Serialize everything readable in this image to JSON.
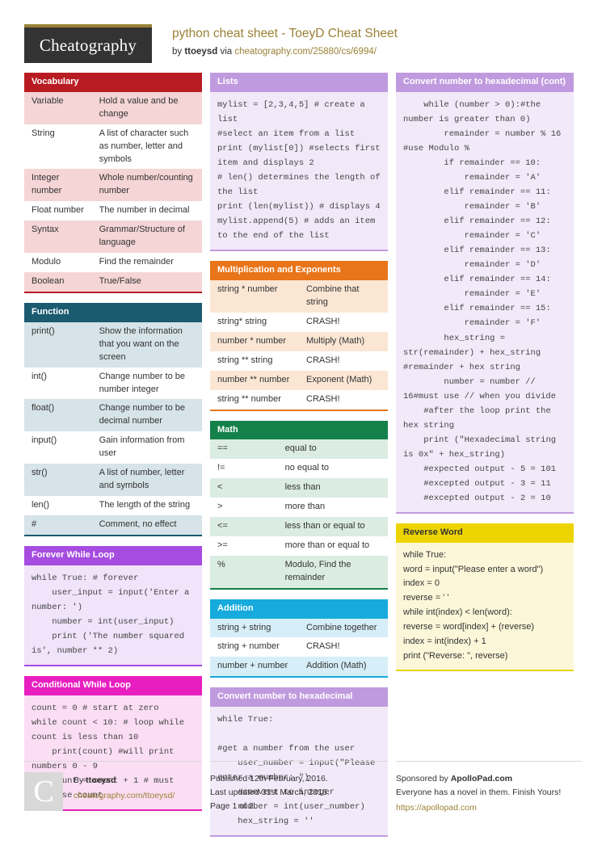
{
  "header": {
    "logo_text": "Cheatography",
    "sheet_title": "python cheat sheet - ToeyD Cheat Sheet",
    "by_prefix": "by ",
    "author": "ttoeysd",
    "via": " via ",
    "source_link": "cheatography.com/25880/cs/6994/"
  },
  "colors": {
    "brand_gold": "#9a8236",
    "vocabulary": "#b81c22",
    "function": "#1a5b70",
    "forever_while_loop": "#a64ce0",
    "conditional_while_loop": "#e81ec0",
    "lists": "#c09ade",
    "multiplication": "#e8751a",
    "math": "#14804a",
    "addition": "#16aadd",
    "hexadecimal": "#c09ade",
    "reverse_word": "#edd400"
  },
  "column1": {
    "vocabulary": {
      "title": "Vocabulary",
      "rows": [
        [
          "Variable",
          "Hold a value and be change"
        ],
        [
          "String",
          "A list of character such as number, letter and symbols"
        ],
        [
          "Integer number",
          "Whole number/counting number"
        ],
        [
          "Float number",
          "The number in decimal"
        ],
        [
          "Syntax",
          "Grammar/Structure of language"
        ],
        [
          "Modulo",
          "Find the remainder"
        ],
        [
          "Boolean",
          "True/False"
        ]
      ]
    },
    "function": {
      "title": "Function",
      "rows": [
        [
          "print()",
          "Show the information that you want on the screen"
        ],
        [
          "int()",
          "Change number to be number integer"
        ],
        [
          "float()",
          "Change number to be decimal number"
        ],
        [
          "input()",
          "Gain information from user"
        ],
        [
          "str()",
          "A list of number, letter and symbols"
        ],
        [
          "len()",
          "The length of the string"
        ],
        [
          "#",
          "Comment, no effect"
        ]
      ]
    },
    "forever_while_loop": {
      "title": "Forever While Loop",
      "code": "while True: # forever\n    user_input = input('Enter a number: ')\n    number = int(user_input)\n    print ('The number squared is', number ** 2)"
    },
    "conditional_while_loop": {
      "title": "Conditional While Loop",
      "code": "count = 0 # start at zero\nwhile count < 10: # loop while count is less than 10\n    print(count) #will print numbers 0 - 9\n    count = count + 1 # must increase count"
    }
  },
  "column2": {
    "lists": {
      "title": "Lists",
      "code": "mylist = [2,3,4,5] # create a list\n#select an item from a list\nprint (mylist[0]) #selects first item and displays 2\n# len() determines the length of the list\nprint (len(mylist)) # displays 4\nmylist.append(5) # adds an item to the end of the list"
    },
    "multiplication": {
      "title": "Multiplication and Exponents",
      "rows": [
        [
          "string * number",
          "Combine that string"
        ],
        [
          "string* string",
          "CRASH!"
        ],
        [
          "number * number",
          "Multiply (Math)"
        ],
        [
          "string ** string",
          "CRASH!"
        ],
        [
          "number ** number",
          "Exponent (Math)"
        ],
        [
          "string ** number",
          "CRASH!"
        ]
      ]
    },
    "math": {
      "title": "Math",
      "rows": [
        [
          "==",
          "equal to"
        ],
        [
          "!=",
          "no equal to"
        ],
        [
          "<",
          "less than"
        ],
        [
          ">",
          "more than"
        ],
        [
          "<=",
          "less than or equal to"
        ],
        [
          ">=",
          "more than or equal to"
        ],
        [
          "%",
          "Modulo, Find the remainder"
        ]
      ]
    },
    "addition": {
      "title": "Addition",
      "rows": [
        [
          "string + string",
          "Combine together"
        ],
        [
          "string + number",
          "CRASH!"
        ],
        [
          "number + number",
          "Addition (Math)"
        ]
      ]
    },
    "hexadecimal": {
      "title": "Convert number to hexadecimal",
      "code": "while True:\n\n#get a number from the user\n    user_number = input(\"Please enter a number: \")\n    #convert to integer\n    number = int(user_number)\n    hex_string = ''"
    }
  },
  "column3": {
    "hexadecimal_cont": {
      "title": "Convert number to hexadecimal (cont)",
      "code": "    while (number > 0):#the number is greater than 0)\n        remainder = number % 16 #use Modulo %\n        if remainder == 10:\n            remainder = 'A'\n        elif remainder == 11:\n            remainder = 'B'\n        elif remainder == 12:\n            remainder = 'C'\n        elif remainder == 13:\n            remainder = 'D'\n        elif remainder == 14:\n            remainder = 'E'\n        elif remainder == 15:\n            remainder = 'F'\n        hex_string = str(remainder) + hex_string #remainder + hex string\n        number = number // 16#must use // when you divide\n    #after the loop print the hex string\n    print (\"Hexadecimal string is 0x\" + hex_string)\n    #expected output - 5 = 101\n    #excepted output - 3 = 11\n    #excepted output - 2 = 10"
    },
    "reverse_word": {
      "title": "Reverse Word",
      "code": "while True:\nword = input(\"Please enter a word\")\nindex = 0\nreverse = ' '\nwhile int(index) < len(word):\nreverse = word[index] + (reverse)\nindex = int(index) + 1\nprint (\"Reverse: \", reverse)"
    }
  },
  "footer": {
    "avatar_letter": "C",
    "by_label": "By ",
    "author": "ttoeysd",
    "author_link": "cheatography.com/ttoeysd/",
    "published": "Published 12th February, 2016.",
    "updated": "Last updated 31st March, 2016.",
    "page": "Page 1 of 2.",
    "sponsor_prefix": "Sponsored by ",
    "sponsor_name": "ApolloPad.com",
    "sponsor_tagline": "Everyone has a novel in them. Finish Yours!",
    "sponsor_link": "https://apollopad.com"
  }
}
